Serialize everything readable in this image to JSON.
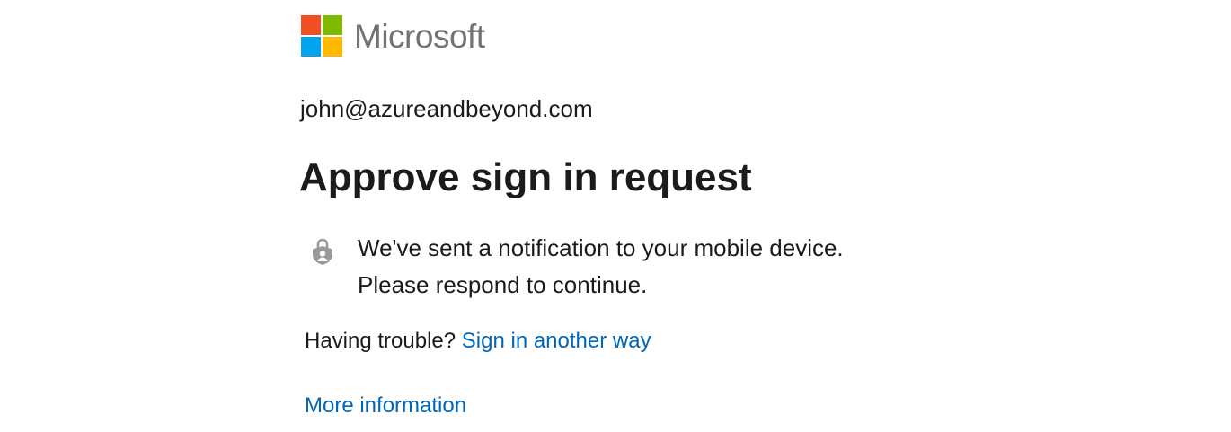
{
  "brand": {
    "name": "Microsoft",
    "logo_colors": [
      "#f25022",
      "#7fba00",
      "#00a4ef",
      "#ffb900"
    ],
    "text_color": "#737373"
  },
  "account": {
    "email": "john@azureandbeyond.com"
  },
  "heading": {
    "title": "Approve sign in request"
  },
  "notification": {
    "icon": "lock-icon",
    "line1": "We've sent a notification to your mobile device.",
    "line2": "Please respond to continue."
  },
  "trouble": {
    "prompt": "Having trouble?",
    "link_label": "Sign in another way"
  },
  "more_info": {
    "label": "More information"
  },
  "colors": {
    "link": "#0067b8",
    "text": "#1b1b1b",
    "icon": "#9a9a9a"
  }
}
